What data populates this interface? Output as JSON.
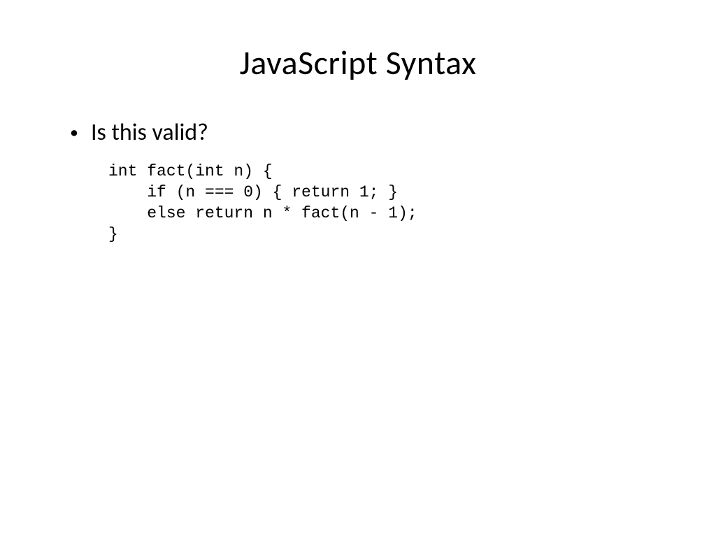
{
  "title": "JavaScript Syntax",
  "bullet": {
    "marker": "•",
    "text": "Is this valid?"
  },
  "code": "int fact(int n) {\n    if (n === 0) { return 1; }\n    else return n * fact(n - 1);\n}"
}
